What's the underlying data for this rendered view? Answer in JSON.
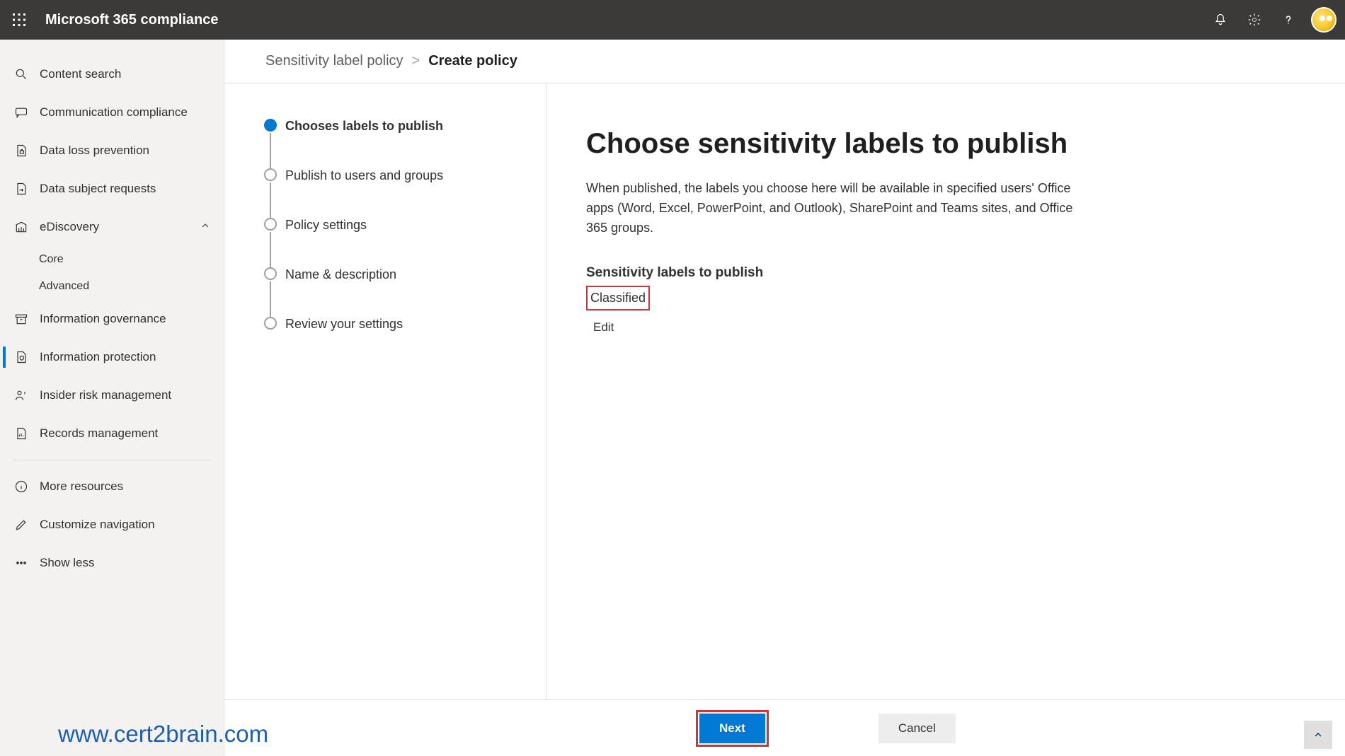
{
  "header": {
    "app_title": "Microsoft 365 compliance"
  },
  "sidebar": {
    "items": [
      {
        "icon": "search",
        "label": "Content search"
      },
      {
        "icon": "chat",
        "label": "Communication compliance"
      },
      {
        "icon": "doc-lock",
        "label": "Data loss prevention"
      },
      {
        "icon": "doc-arrow",
        "label": "Data subject requests"
      },
      {
        "icon": "library",
        "label": "eDiscovery",
        "expandable": true,
        "children": [
          {
            "label": "Core"
          },
          {
            "label": "Advanced"
          }
        ]
      },
      {
        "icon": "archive",
        "label": "Information governance"
      },
      {
        "icon": "shield-doc",
        "label": "Information protection",
        "selected": true
      },
      {
        "icon": "person-risk",
        "label": "Insider risk management"
      },
      {
        "icon": "doc-chart",
        "label": "Records management"
      }
    ],
    "more_resources": "More resources",
    "customize_nav": "Customize navigation",
    "show_less": "Show less"
  },
  "breadcrumb": {
    "parent": "Sensitivity label policy",
    "current": "Create policy"
  },
  "stepper": [
    {
      "label": "Chooses labels to publish",
      "active": true
    },
    {
      "label": "Publish to users and groups"
    },
    {
      "label": "Policy settings"
    },
    {
      "label": "Name & description"
    },
    {
      "label": "Review your settings"
    }
  ],
  "detail": {
    "heading": "Choose sensitivity labels to publish",
    "description": "When published, the labels you choose here will be available in specified users' Office apps (Word, Excel, PowerPoint, and Outlook), SharePoint and Teams sites, and Office 365 groups.",
    "subhead": "Sensitivity labels to publish",
    "selected_label": "Classified",
    "edit_link": "Edit"
  },
  "footer": {
    "next": "Next",
    "cancel": "Cancel"
  },
  "watermark": "www.cert2brain.com"
}
